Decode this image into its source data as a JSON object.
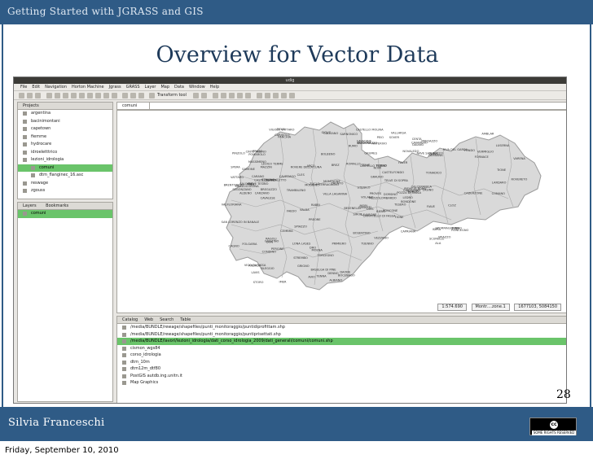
{
  "slide": {
    "header_title": "Getting Started with JGRASS and GIS",
    "title": "Overview for Vector Data",
    "author": "Silvia Franceschi",
    "page_number": "28",
    "date": "Friday, September 10, 2010",
    "license": "SOME RIGHTS RESERVED",
    "license_badge": "cc"
  },
  "app": {
    "window_title": "udig",
    "menu": [
      "File",
      "Edit",
      "Navigation",
      "Horton Machine",
      "Jgrass",
      "GRASS",
      "Layer",
      "Map",
      "Data",
      "Window",
      "Help"
    ],
    "toolbar_label": "Transform tool",
    "projects_tab": "Projects",
    "map_tab": "comuni",
    "projects": [
      {
        "label": "argentina",
        "level": 0
      },
      {
        "label": "bacinimontani",
        "level": 0
      },
      {
        "label": "capetown",
        "level": 0
      },
      {
        "label": "fiemme",
        "level": 0
      },
      {
        "label": "hydrocare",
        "level": 0
      },
      {
        "label": "idroeletttrico",
        "level": 0
      },
      {
        "label": "lezioni_idrologia",
        "level": 0
      },
      {
        "label": "comuni",
        "level": 1,
        "selected": true
      },
      {
        "label": "dtm_flanginec_16.asc",
        "level": 1
      },
      {
        "label": "reswage",
        "level": 0
      },
      {
        "label": "zgouss",
        "level": 0
      }
    ],
    "layers_tab": "Layers",
    "bookmarks_tab": "Bookmarks",
    "layers": [
      {
        "label": "comuni",
        "selected": true
      }
    ],
    "catalog_tabs": [
      "Catalog",
      "Web",
      "Search",
      "Table"
    ],
    "catalog": [
      {
        "label": "/media/BUNDLE/rewage/shapefiles/punti_monitoraggio/puntidiprofittam.shp"
      },
      {
        "label": "/media/BUNDLE/rewage/shapefiles/punti_monitoraggio/puntiprisettati.shp"
      },
      {
        "label": "/media/BUNDLE/lavori/lezioni_idrologia/dati_corso_idrologia_2009/dati_generali/comuni/comuni.shp",
        "selected": true
      },
      {
        "label": "cismon_wgs84"
      },
      {
        "label": "corso_idrologia"
      },
      {
        "label": "dtm_10m"
      },
      {
        "label": "dtm12m_dtf80"
      },
      {
        "label": "PostGIS autdb.ing.unitn.it"
      },
      {
        "label": "Map Graphics"
      }
    ],
    "status": {
      "scale": "1:574.690",
      "crs": "Montr....zone.1",
      "coords": "1677103, 5084150"
    },
    "map_labels": [
      "CAMPITELLO DI FASSA",
      "MAZZIN",
      "CANAZEI",
      "VIGO DI FASSA",
      "POZZA DI FASSA",
      "MOENA",
      "PREDAZZO",
      "FORNO",
      "ZIANO",
      "TESERO",
      "PANCHIA",
      "CAVALESE",
      "VARENA",
      "SIROR",
      "TONADICO",
      "IMER",
      "TELVE",
      "TELVE DI SOPRA",
      "PERGINE",
      "TRENTO",
      "LAVIS",
      "GRIGNO",
      "CASTELLO TESINO",
      "BORGO",
      "RONCEGNO",
      "LEVICO TERME",
      "CALDONAZZO",
      "ALDENO",
      "ISERA",
      "ROVERETO",
      "MORI",
      "VOLANO",
      "ARCO",
      "RIVA DEL GARDA",
      "DRO",
      "TENNO",
      "VALLARSA",
      "TERRAGNOLO",
      "TRAMBILENO",
      "ALA",
      "AVIO",
      "BRENTONICO",
      "LEDRO",
      "STORO",
      "BONDONE",
      "CONDINO",
      "TIONE",
      "PINZOLO",
      "SPIAZZO",
      "STREMBO",
      "CARISOLO",
      "VERMIGLIO",
      "PEIO",
      "RABBI",
      "MALE",
      "CLES",
      "FONDO",
      "REVO",
      "CAVARENO",
      "RUMO",
      "PROVES",
      "CAGNO",
      "TUENNO",
      "DENNO",
      "SPORMAGGIORE",
      "MOLVENO",
      "ANDALO",
      "CAVEDAGO",
      "SAN LORENZO IN BANALE",
      "STENICO",
      "DORSINO",
      "BLEGGIO",
      "FIAVE",
      "COMANO",
      "VEZZANO",
      "CAVEDINE",
      "LASINO",
      "MEZZOLOMBARDO",
      "MEZZOCORONA",
      "NAVE SAN ROCCO",
      "ZAMBANA",
      "FAEDO",
      "GIOVO",
      "SEGONZANO",
      "CEMBRA",
      "LONA LASES",
      "BASELGA DI PINE",
      "CIVEZZANO",
      "FORNACE",
      "VILLA LAGARINA",
      "POMAROLO",
      "NOMI",
      "BESENELLO",
      "CALLIANO",
      "FOLGARIA",
      "LAVARONE",
      "LUSERNA",
      "ROMALLO",
      "SARNONICO",
      "DON",
      "AMBLAR",
      "CASTELFONDO",
      "BREZ",
      "CLOZ",
      "SPIAZZO",
      "BOCENAGO",
      "CADERZONE",
      "MASSIMENO",
      "GIUSTINO",
      "ZUCLO",
      "BOLBENO",
      "PREORE",
      "RAGOLI",
      "MONTAGNE",
      "TIONE",
      "BREGUZZO",
      "RONCONE",
      "PIEVE DI BONO",
      "PRASO",
      "DAONE",
      "BERSONE",
      "LARDARO",
      "ROVERE DELLA LUNA",
      "SALORNO",
      "ALBIANO",
      "SOVER",
      "GRUMES",
      "GRAUNO",
      "VALDA",
      "FAVER",
      "CAPRIANA",
      "ANTERIVO",
      "VALFLORIANA",
      "CASTELLO MOLINA",
      "DAIANO",
      "CARANO",
      "BOSENTINO",
      "VIGOLO VATTARO",
      "VATTARO",
      "CENTA",
      "CALCERANICA",
      "TENNA",
      "NOVALEDO",
      "SCURELLE",
      "SPERA",
      "STRIGNO",
      "SAMONE",
      "BIENO",
      "PIEVE TESINO",
      "CINTE TESINO",
      "OSPEDALETTO",
      "CASTELNUOVO",
      "CARZANO",
      "TORCEGNO",
      "OVIS",
      "PRIMIERO"
    ]
  }
}
